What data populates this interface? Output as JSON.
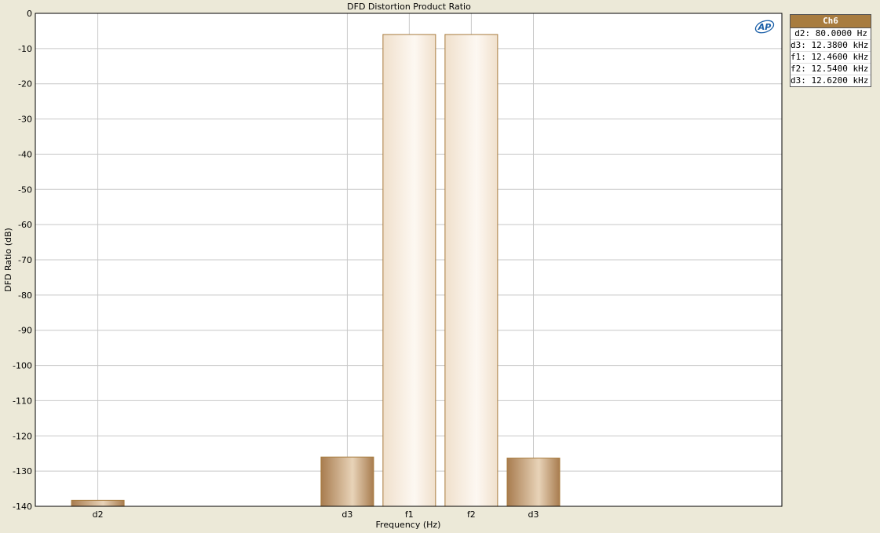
{
  "chart_data": {
    "type": "bar",
    "title": "DFD Distortion Product Ratio",
    "xlabel": "Frequency (Hz)",
    "ylabel": "DFD Ratio (dB)",
    "ylim": [
      -140,
      0
    ],
    "yticks": [
      0,
      -10,
      -20,
      -30,
      -40,
      -50,
      -60,
      -70,
      -80,
      -90,
      -100,
      -110,
      -120,
      -130,
      -140
    ],
    "categories": [
      "d2",
      "d3",
      "f1",
      "f2",
      "d3"
    ],
    "values": [
      -138.3,
      -126.0,
      -6.0,
      -6.0,
      -126.3
    ],
    "bar_styles": [
      "distortion",
      "distortion",
      "fundamental",
      "fundamental",
      "distortion"
    ],
    "grid": true,
    "legend_placement": "outside-right"
  },
  "legend": {
    "header": "Ch6",
    "rows": [
      "d2: 80.0000 Hz",
      "d3: 12.3800 kHz",
      "f1: 12.4600 kHz",
      "f2: 12.5400 kHz",
      "d3: 12.6200 kHz"
    ]
  },
  "logo": {
    "text": "AP",
    "color": "#1a5fa8"
  },
  "colors": {
    "distortion_bar_dark": "#a87c4f",
    "distortion_bar_light": "#e8d3b8",
    "fundamental_bar_dark": "#f0e0cc",
    "fundamental_bar_light": "#fdf8f2",
    "bar_border": "#a87c3f",
    "grid": "#c8c8c8",
    "plot_bg": "#ffffff",
    "legend_header_bg": "#a87c3f"
  }
}
